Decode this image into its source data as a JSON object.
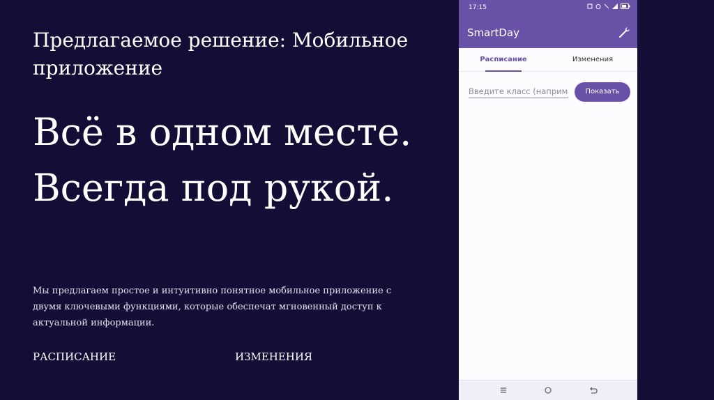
{
  "slide": {
    "kicker": "Предлагаемое решение: Мобильное приложение",
    "headline": "Всё в одном месте. Всегда под рукой.",
    "description": "Мы предлагаем простое и интуитивно понятное мобильное приложение с двумя ключевыми функциями, которые обеспечат мгновенный доступ к актуальной информации.",
    "features": [
      "РАСПИСАНИЕ",
      "ИЗМЕНЕНИЯ"
    ]
  },
  "phone": {
    "status": {
      "time": "17:15",
      "icons": [
        "telegram-icon",
        "youtube-icon",
        "nfc-icon",
        "alarm-icon",
        "mute-icon",
        "speed-icon",
        "network-icon",
        "battery-icon"
      ]
    },
    "app_title": "SmartDay",
    "settings_icon": "wrench-icon",
    "tabs": [
      "Расписание",
      "Изменения"
    ],
    "active_tab": "Расписание",
    "input_placeholder": "Введите класс (наприм",
    "show_button": "Показать",
    "nav_icons": [
      "menu-icon",
      "home-icon",
      "back-icon"
    ]
  },
  "colors": {
    "background": "#120e36",
    "accent": "#6a51a8",
    "phone_bg": "#fcfbfe"
  }
}
